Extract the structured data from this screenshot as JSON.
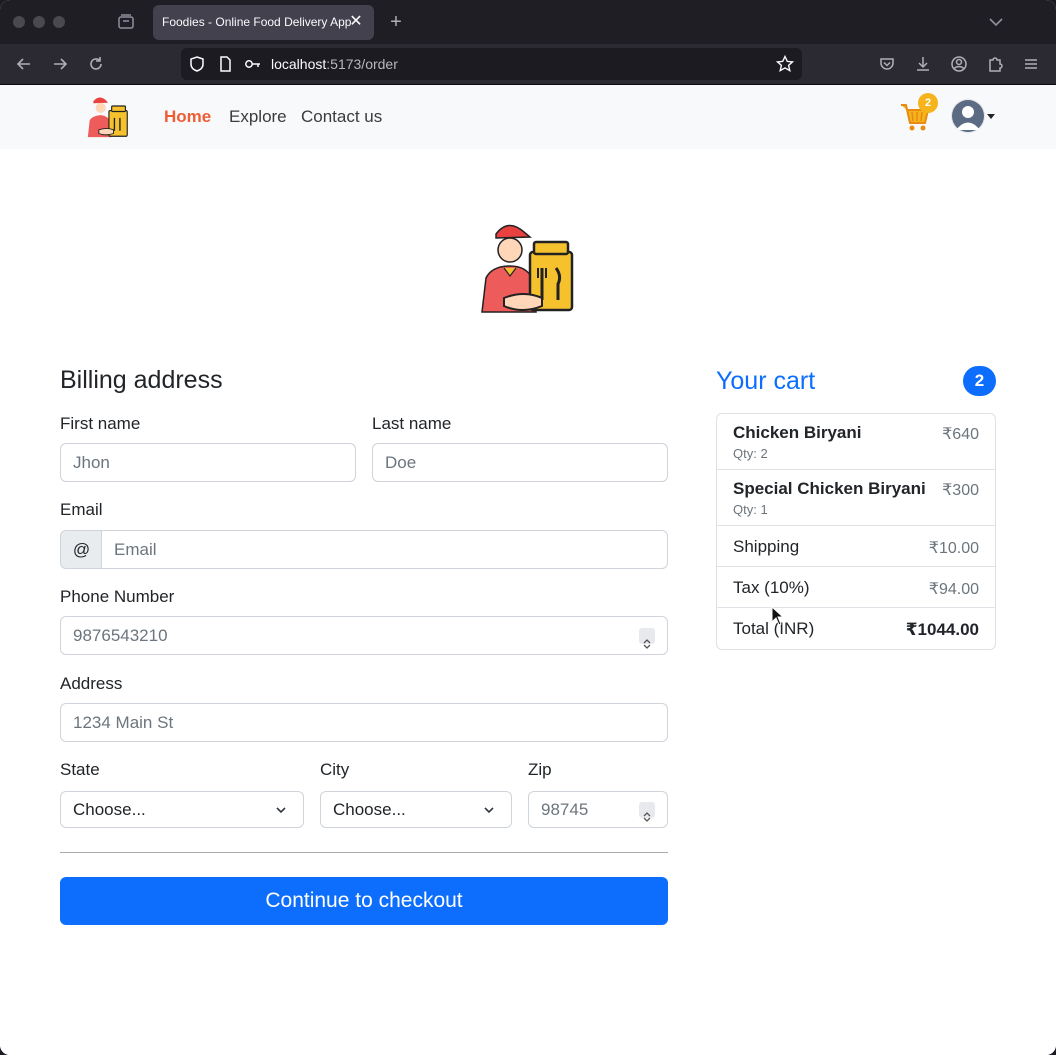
{
  "browser": {
    "tab_title": "Foodies - Online Food Delivery App",
    "url_host": "localhost",
    "url_path": ":5173/order"
  },
  "site_nav": {
    "links": [
      {
        "label": "Home",
        "active": true
      },
      {
        "label": "Explore",
        "active": false
      },
      {
        "label": "Contact us",
        "active": false
      }
    ],
    "cart_badge": "2"
  },
  "billing": {
    "heading": "Billing address",
    "first_name": {
      "label": "First name",
      "placeholder": "Jhon"
    },
    "last_name": {
      "label": "Last name",
      "placeholder": "Doe"
    },
    "email": {
      "label": "Email",
      "addon": "@",
      "placeholder": "Email"
    },
    "phone": {
      "label": "Phone Number",
      "placeholder": "9876543210"
    },
    "address": {
      "label": "Address",
      "placeholder": "1234 Main St"
    },
    "state": {
      "label": "State",
      "value": "Choose..."
    },
    "city": {
      "label": "City",
      "value": "Choose..."
    },
    "zip": {
      "label": "Zip",
      "placeholder": "98745"
    },
    "checkout_button": "Continue to checkout"
  },
  "cart": {
    "heading": "Your cart",
    "count": "2",
    "items": [
      {
        "name": "Chicken Biryani",
        "qty": "Qty: 2",
        "price": "₹640"
      },
      {
        "name": "Special Chicken Biryani",
        "qty": "Qty: 1",
        "price": "₹300"
      }
    ],
    "shipping": {
      "label": "Shipping",
      "value": "₹10.00"
    },
    "tax": {
      "label": "Tax (10%)",
      "value": "₹94.00"
    },
    "total": {
      "label": "Total (INR)",
      "value": "₹1044.00"
    }
  },
  "colors": {
    "brand_orange": "#ee5e36",
    "primary_blue": "#0d6efd",
    "cart_badge": "#f5b41b"
  }
}
